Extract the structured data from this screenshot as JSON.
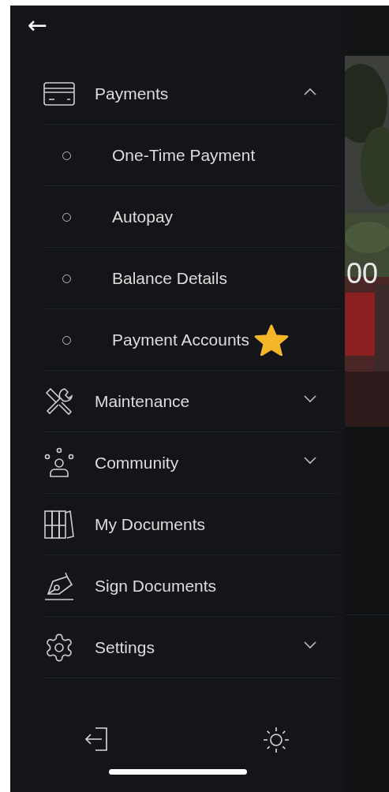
{
  "back_button": {
    "label": "←"
  },
  "menu": [
    {
      "kind": "group",
      "label": "Payments",
      "expanded": true,
      "children": [
        {
          "label": "One-Time Payment",
          "favorite": false
        },
        {
          "label": "Autopay",
          "favorite": false
        },
        {
          "label": "Balance Details",
          "favorite": false
        },
        {
          "label": "Payment Accounts",
          "favorite": true
        }
      ]
    },
    {
      "kind": "group",
      "label": "Maintenance",
      "expanded": false
    },
    {
      "kind": "group",
      "label": "Community",
      "expanded": false
    },
    {
      "kind": "link",
      "label": "My Documents"
    },
    {
      "kind": "link",
      "label": "Sign Documents"
    },
    {
      "kind": "group",
      "label": "Settings",
      "expanded": false
    }
  ],
  "background": {
    "amount_fragment": "00"
  }
}
